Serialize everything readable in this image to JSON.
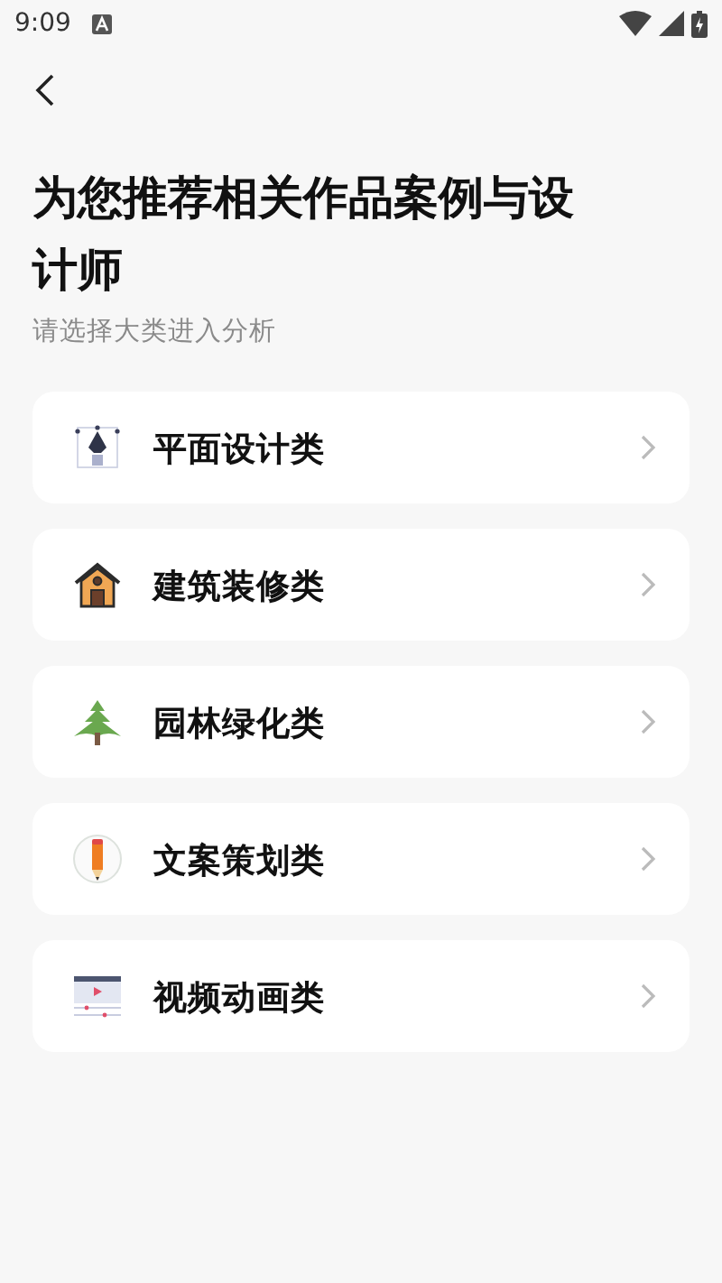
{
  "status_bar": {
    "time": "9:09"
  },
  "title": "为您推荐相关作品案例与设计师",
  "subtitle": "请选择大类进入分析",
  "categories": [
    {
      "kind": "graphic",
      "label": "平面设计类"
    },
    {
      "kind": "architecture",
      "label": "建筑装修类"
    },
    {
      "kind": "landscape",
      "label": "园林绿化类"
    },
    {
      "kind": "copywriting",
      "label": "文案策划类"
    },
    {
      "kind": "video",
      "label": "视频动画类"
    }
  ]
}
